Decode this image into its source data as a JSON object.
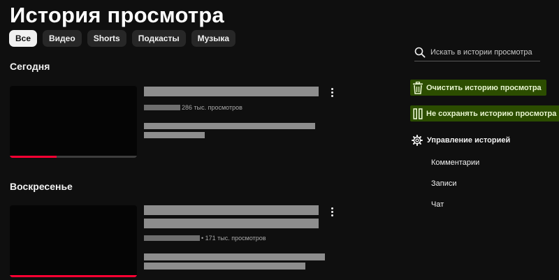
{
  "page": {
    "title": "История просмотра"
  },
  "filters": [
    {
      "label": "Все",
      "active": true
    },
    {
      "label": "Видео",
      "active": false
    },
    {
      "label": "Shorts",
      "active": false
    },
    {
      "label": "Подкасты",
      "active": false
    },
    {
      "label": "Музыка",
      "active": false
    }
  ],
  "sections": [
    {
      "heading": "Сегодня",
      "video": {
        "views": "286 тыс. просмотров",
        "watch_progress": 0.37
      }
    },
    {
      "heading": "Воскресенье",
      "video": {
        "views": "• 171 тыс. просмотров",
        "watch_progress": 1.0
      }
    }
  ],
  "sidebar": {
    "search_placeholder": "Искать в истории просмотра",
    "clear_label": "Очистить историю просмотра",
    "pause_label": "Не сохранять историю просмотра",
    "manage_label": "Управление историей",
    "links": [
      "Комментарии",
      "Записи",
      "Чат"
    ]
  },
  "icons": {
    "search": "search-icon",
    "clear": "trash-icon",
    "pause": "pause-icon",
    "manage": "gear-icon",
    "more": "more-vertical-icon"
  },
  "colors": {
    "background": "#0f0f0f",
    "chip_active": "#f1f1f1",
    "progress": "#ff0033",
    "action_highlight": "#2c4d00"
  }
}
